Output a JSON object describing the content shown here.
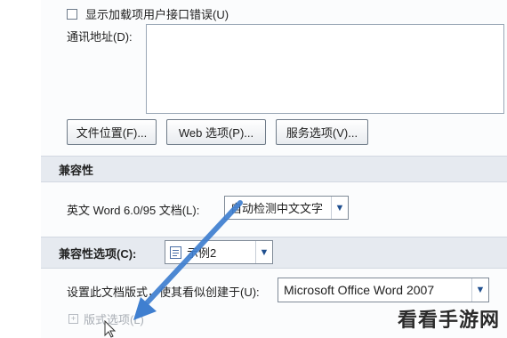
{
  "addin_errors": {
    "label": "显示加载项用户接口错误(U)",
    "checked": false
  },
  "mailing_address": {
    "label": "通讯地址(D):",
    "value": ""
  },
  "buttons": {
    "file_locations": "文件位置(F)...",
    "web_options": "Web 选项(P)...",
    "service_options": "服务选项(V)..."
  },
  "compat": {
    "section_title": "兼容性",
    "label": "英文 Word 6.0/95 文档(L):",
    "value": "自动检测中文文字"
  },
  "compat_options": {
    "section_title": "兼容性选项(C):",
    "doc_value": "示例2",
    "layout_label": "设置此文档版式，使其看似创建于(U):",
    "layout_value": "Microsoft Office Word 2007",
    "layout_options_link": "版式选项(L)"
  },
  "watermark": "看看手游网",
  "colors": {
    "section_bg": "#e6eaf0",
    "arrow": "#3f7fd0"
  }
}
